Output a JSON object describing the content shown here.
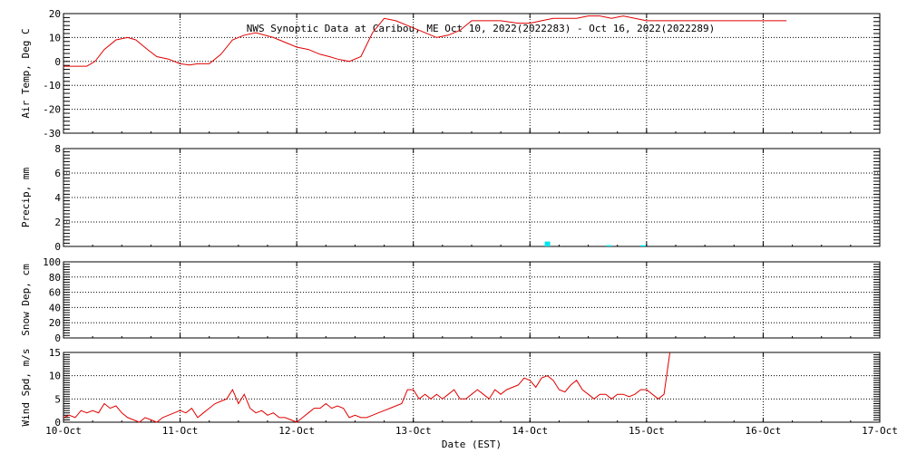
{
  "chart_data": [
    {
      "type": "line",
      "title": "NWS Synoptic Data at Caribou, ME   Oct 10, 2022(2022283) - Oct 16, 2022(2022289)",
      "ylabel": "Air Temp, Deg C",
      "ylim": [
        -30,
        20
      ],
      "yticks": [
        "20",
        "10",
        "0",
        "-10",
        "-20",
        "-30"
      ],
      "grid": true,
      "series": [
        {
          "x": [
            0,
            0.08,
            0.2,
            0.27,
            0.35,
            0.45,
            0.55,
            0.62,
            0.72,
            0.8,
            0.9,
            1,
            1.08,
            1.15,
            1.25,
            1.35,
            1.45,
            1.55,
            1.65,
            1.8,
            2,
            2.1,
            2.2,
            2.28,
            2.35,
            2.45,
            2.55,
            2.65,
            2.75,
            2.85,
            2.95,
            3,
            3.1,
            3.2,
            3.3,
            3.4,
            3.5,
            3.6,
            3.75,
            3.9,
            4,
            4.1,
            4.2,
            4.3,
            4.4,
            4.5,
            4.6,
            4.7,
            4.8,
            4.9,
            5,
            5.1,
            5.2,
            5.4,
            5.6,
            5.8,
            6,
            6.2
          ],
          "y": [
            -2,
            -2,
            -2,
            0,
            5,
            9,
            10,
            9,
            5,
            2,
            1,
            -1,
            -1.5,
            -1,
            -1,
            3,
            9,
            11,
            12,
            10,
            6,
            5,
            3,
            2,
            1,
            0,
            2,
            12,
            18,
            17,
            15,
            14,
            12,
            10,
            11,
            13,
            17,
            17,
            17,
            16,
            16,
            17,
            18,
            18,
            18,
            19,
            19,
            18,
            19,
            18,
            17,
            17,
            17,
            17,
            17,
            17,
            17,
            17
          ]
        }
      ]
    },
    {
      "type": "bar",
      "ylabel": "Precip, mm",
      "ylim": [
        0,
        8
      ],
      "yticks": [
        "8",
        "6",
        "4",
        "2",
        "0"
      ],
      "grid": true,
      "series": [
        {
          "x": [
            4.15,
            4.68,
            4.97
          ],
          "values": [
            0.4,
            0.1,
            0.1
          ]
        }
      ],
      "bar_color": "#00e5ee"
    },
    {
      "type": "line",
      "ylabel": "Snow Dep, cm",
      "ylim": [
        0,
        100
      ],
      "yticks": [
        "100",
        "80",
        "60",
        "40",
        "20",
        "0"
      ],
      "grid": true,
      "series": []
    },
    {
      "type": "line",
      "ylabel": "Wind Spd, m/s",
      "ylim": [
        0,
        15
      ],
      "yticks": [
        "15",
        "10",
        "5",
        "0"
      ],
      "xlabel": "Date (EST)",
      "xlim": [
        0,
        7
      ],
      "categories": [
        "10-Oct",
        "11-Oct",
        "12-Oct",
        "13-Oct",
        "14-Oct",
        "15-Oct",
        "16-Oct",
        "17-Oct"
      ],
      "grid": true,
      "series": [
        {
          "x": [
            0,
            0.05,
            0.1,
            0.15,
            0.2,
            0.25,
            0.3,
            0.35,
            0.4,
            0.45,
            0.5,
            0.55,
            0.6,
            0.65,
            0.7,
            0.75,
            0.8,
            0.85,
            0.9,
            0.95,
            1,
            1.05,
            1.1,
            1.15,
            1.2,
            1.25,
            1.3,
            1.35,
            1.4,
            1.45,
            1.5,
            1.55,
            1.6,
            1.65,
            1.7,
            1.75,
            1.8,
            1.85,
            1.9,
            1.95,
            2,
            2.05,
            2.1,
            2.15,
            2.2,
            2.25,
            2.3,
            2.35,
            2.4,
            2.45,
            2.5,
            2.55,
            2.6,
            2.65,
            2.7,
            2.75,
            2.8,
            2.85,
            2.9,
            2.95,
            3,
            3.05,
            3.1,
            3.15,
            3.2,
            3.25,
            3.3,
            3.35,
            3.4,
            3.45,
            3.5,
            3.55,
            3.6,
            3.65,
            3.7,
            3.75,
            3.8,
            3.85,
            3.9,
            3.95,
            4,
            4.05,
            4.1,
            4.15,
            4.2,
            4.25,
            4.3,
            4.35,
            4.4,
            4.45,
            4.5,
            4.55,
            4.6,
            4.65,
            4.7,
            4.75,
            4.8,
            4.85,
            4.9,
            4.95,
            5,
            5.05,
            5.1,
            5.15,
            5.2
          ],
          "y": [
            1,
            1.5,
            1,
            2.5,
            2,
            2.5,
            2,
            4,
            3,
            3.5,
            2,
            1,
            0.5,
            0,
            1,
            0.5,
            0,
            1,
            1.5,
            2,
            2.5,
            2,
            3,
            1,
            2,
            3,
            4,
            4.5,
            5,
            7,
            4,
            6,
            3,
            2,
            2.5,
            1.5,
            2,
            1,
            1,
            0.5,
            0,
            1,
            2,
            3,
            3,
            4,
            3,
            3.5,
            3,
            1,
            1.5,
            1,
            1,
            1.5,
            2,
            2.5,
            3,
            3.5,
            4,
            7,
            7,
            5,
            6,
            5,
            6,
            5,
            6,
            7,
            5,
            5,
            6,
            7,
            6,
            5,
            7,
            6,
            7,
            7.5,
            8,
            9.5,
            9,
            7.5,
            9.5,
            10,
            9,
            7,
            6.5,
            8,
            9,
            7,
            6,
            5,
            6,
            6,
            5,
            6,
            6,
            5.5,
            6,
            7,
            7,
            6,
            5,
            6,
            15
          ]
        }
      ]
    }
  ]
}
